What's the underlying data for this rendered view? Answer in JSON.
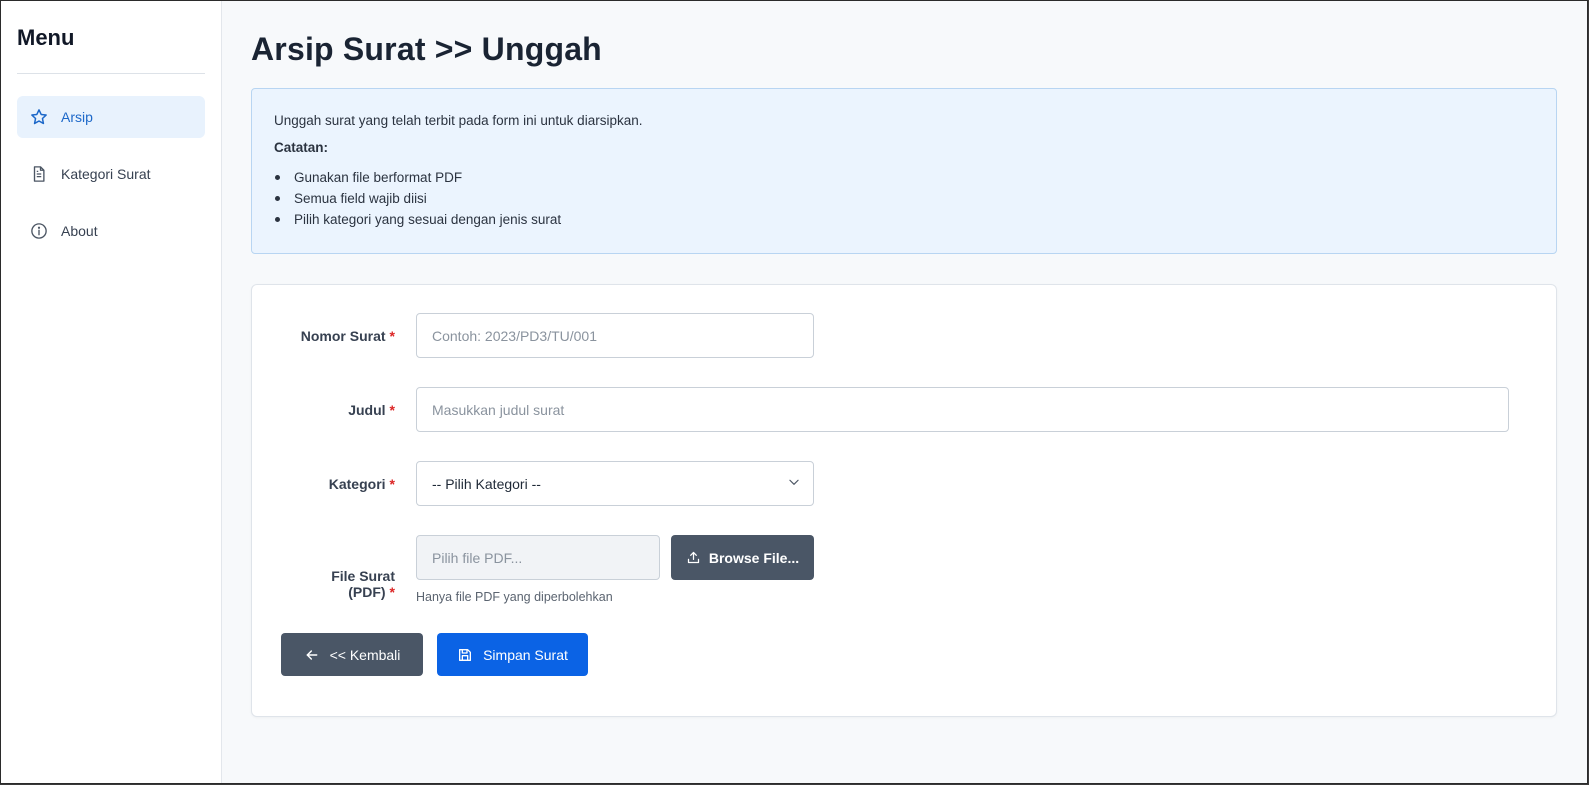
{
  "sidebar": {
    "title": "Menu",
    "items": [
      {
        "label": "Arsip",
        "icon": "star-icon",
        "active": true
      },
      {
        "label": "Kategori Surat",
        "icon": "document-icon",
        "active": false
      },
      {
        "label": "About",
        "icon": "info-icon",
        "active": false
      }
    ]
  },
  "page": {
    "title": "Arsip Surat >> Unggah"
  },
  "info": {
    "intro": "Unggah surat yang telah terbit pada form ini untuk diarsipkan.",
    "note_title": "Catatan:",
    "notes": [
      "Gunakan file berformat PDF",
      "Semua field wajib diisi",
      "Pilih kategori yang sesuai dengan jenis surat"
    ]
  },
  "form": {
    "nomor_label": "Nomor Surat",
    "nomor_placeholder": "Contoh: 2023/PD3/TU/001",
    "judul_label": "Judul",
    "judul_placeholder": "Masukkan judul surat",
    "kategori_label": "Kategori",
    "kategori_selected": "-- Pilih Kategori --",
    "file_label": "File Surat (PDF)",
    "file_placeholder": "Pilih file PDF...",
    "browse_label": "Browse File...",
    "file_help": "Hanya file PDF yang diperbolehkan",
    "required_mark": "*"
  },
  "actions": {
    "back_label": "<< Kembali",
    "save_label": "Simpan Surat"
  },
  "colors": {
    "accent": "#0b63e5",
    "active_nav": "#1d68c9",
    "secondary_button": "#4a5666",
    "required": "#dc2626"
  }
}
